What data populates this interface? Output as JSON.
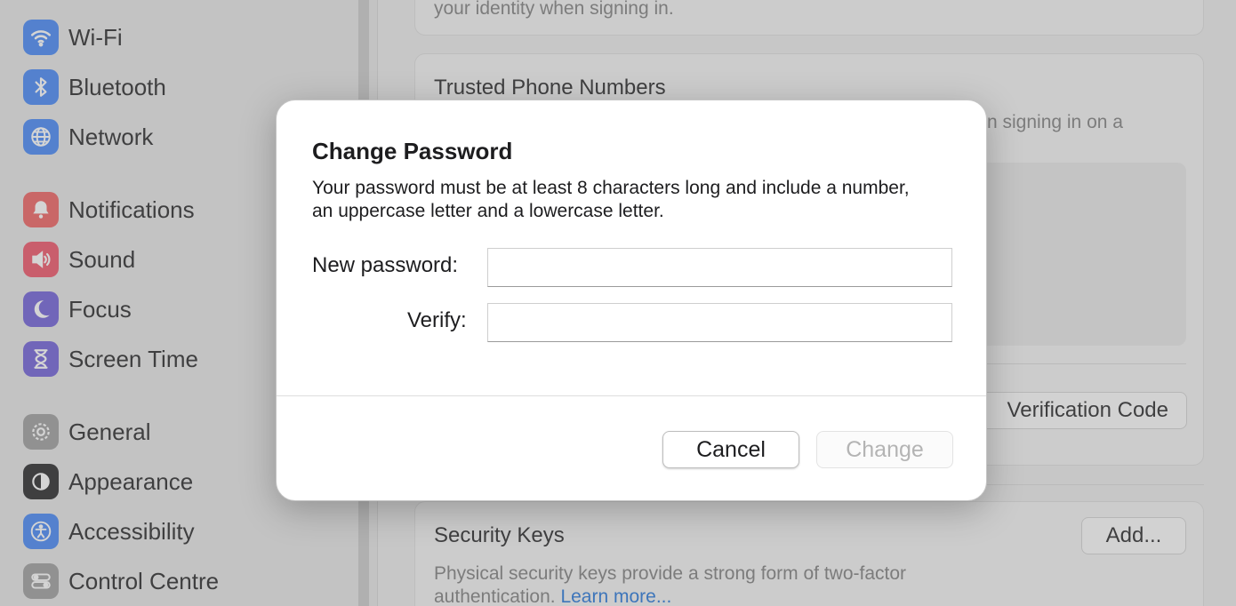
{
  "sidebar": {
    "items": [
      {
        "label": "Wi-Fi",
        "icon": "wifi-icon",
        "color": "#3d82f6"
      },
      {
        "label": "Bluetooth",
        "icon": "bluetooth-icon",
        "color": "#3d82f6"
      },
      {
        "label": "Network",
        "icon": "globe-icon",
        "color": "#3d82f6"
      },
      {
        "label": "Notifications",
        "icon": "bell-icon",
        "color": "#ef5a5a"
      },
      {
        "label": "Sound",
        "icon": "speaker-icon",
        "color": "#ef4c62"
      },
      {
        "label": "Focus",
        "icon": "moon-icon",
        "color": "#6a58d6"
      },
      {
        "label": "Screen Time",
        "icon": "hourglass-icon",
        "color": "#6a58d6"
      },
      {
        "label": "General",
        "icon": "gear-icon",
        "color": "#9a9a9a"
      },
      {
        "label": "Appearance",
        "icon": "appearance-icon",
        "color": "#1d1d1f"
      },
      {
        "label": "Accessibility",
        "icon": "accessibility-icon",
        "color": "#3d82f6"
      },
      {
        "label": "Control Centre",
        "icon": "toggles-icon",
        "color": "#9a9a9a"
      }
    ]
  },
  "main": {
    "top_card_text": "your identity when signing in.",
    "trusted": {
      "title": "Trusted Phone Numbers",
      "desc_visible": "n signing in on a",
      "verification_button": "Verification Code"
    },
    "security_keys": {
      "title": "Security Keys",
      "add_button": "Add...",
      "desc_line1": "Physical security keys provide a strong form of two-factor",
      "desc_line2": "authentication.",
      "learn_more": "Learn more..."
    }
  },
  "dialog": {
    "title": "Change Password",
    "message": "Your password must be at least 8 characters long and include a number, an uppercase letter and a lowercase letter.",
    "new_password_label": "New password:",
    "new_password_value": "",
    "verify_label": "Verify:",
    "verify_value": "",
    "cancel_label": "Cancel",
    "change_label": "Change"
  }
}
